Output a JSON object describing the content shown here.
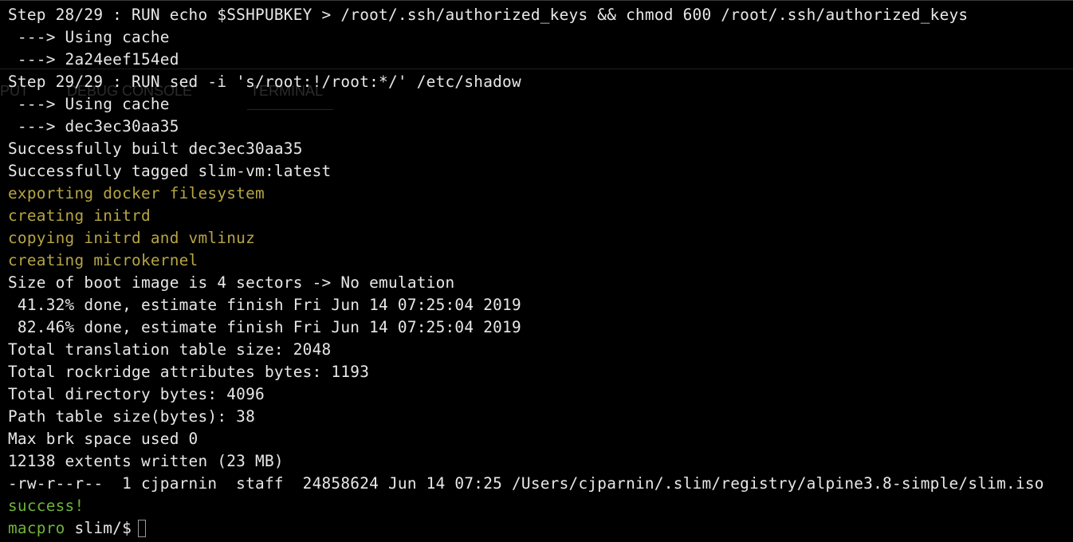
{
  "terminal": {
    "background": "#000000",
    "ghost_tabs": [
      "PUT",
      "DEBUG CONSOLE",
      "TERMINAL"
    ],
    "lines": [
      {
        "text": "Step 28/29 : RUN echo $SSHPUBKEY > /root/.ssh/authorized_keys && chmod 600 /root/.ssh/authorized_keys",
        "color": "#e8e8e8"
      },
      {
        "text": " ---> Using cache",
        "color": "#e8e8e8"
      },
      {
        "text": " ---> 2a24eef154ed",
        "color": "#e8e8e8"
      },
      {
        "text": "Step 29/29 : RUN sed -i 's/root:!/root:*/' /etc/shadow",
        "color": "#e8e8e8"
      },
      {
        "text": " ---> Using cache",
        "color": "#e8e8e8"
      },
      {
        "text": " ---> dec3ec30aa35",
        "color": "#e8e8e8"
      },
      {
        "text": "Successfully built dec3ec30aa35",
        "color": "#e8e8e8"
      },
      {
        "text": "Successfully tagged slim-vm:latest",
        "color": "#e8e8e8"
      },
      {
        "text": "exporting docker filesystem",
        "color": "#b5a545"
      },
      {
        "text": "creating initrd",
        "color": "#b5a545"
      },
      {
        "text": "copying initrd and vmlinuz",
        "color": "#b5a545"
      },
      {
        "text": "creating microkernel",
        "color": "#b5a545"
      },
      {
        "text": "Size of boot image is 4 sectors -> No emulation",
        "color": "#e8e8e8"
      },
      {
        "text": " 41.32% done, estimate finish Fri Jun 14 07:25:04 2019",
        "color": "#e8e8e8"
      },
      {
        "text": " 82.46% done, estimate finish Fri Jun 14 07:25:04 2019",
        "color": "#e8e8e8"
      },
      {
        "text": "Total translation table size: 2048",
        "color": "#e8e8e8"
      },
      {
        "text": "Total rockridge attributes bytes: 1193",
        "color": "#e8e8e8"
      },
      {
        "text": "Total directory bytes: 4096",
        "color": "#e8e8e8"
      },
      {
        "text": "Path table size(bytes): 38",
        "color": "#e8e8e8"
      },
      {
        "text": "Max brk space used 0",
        "color": "#e8e8e8"
      },
      {
        "text": "12138 extents written (23 MB)",
        "color": "#e8e8e8"
      },
      {
        "text": "-rw-r--r--  1 cjparnin  staff  24858624 Jun 14 07:25 /Users/cjparnin/.slim/registry/alpine3.8-simple/slim.iso",
        "color": "#e8e8e8"
      },
      {
        "text": "success!",
        "color": "#6fb33a"
      }
    ],
    "prompt": {
      "host": "macpro",
      "path": " slim/$",
      "host_color": "#6fb33a",
      "input_value": ""
    }
  }
}
